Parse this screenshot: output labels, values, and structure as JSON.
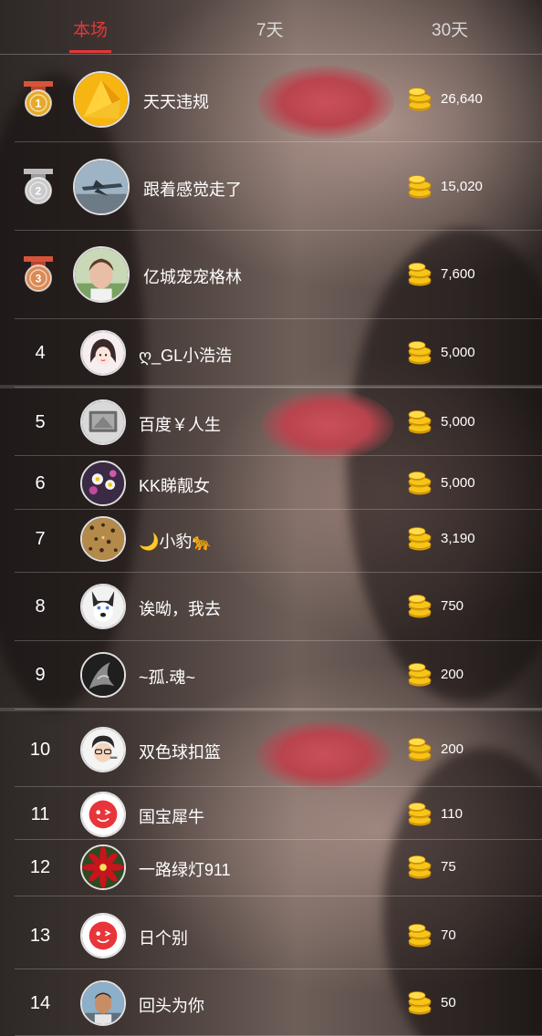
{
  "tabs": [
    {
      "label": "本场",
      "active": true
    },
    {
      "label": "7天",
      "active": false
    },
    {
      "label": "30天",
      "active": false
    }
  ],
  "colors": {
    "accent": "#e8353a",
    "coin": "#f5c518",
    "gold_medal": "#e7a92a",
    "silver_medal": "#c9c9c9",
    "bronze_medal": "#d98a55"
  },
  "ranking": [
    {
      "rank": "1",
      "medal": "gold",
      "name": "天天违规",
      "amount": "26,640",
      "avatar": "yellow-geometric-avatar"
    },
    {
      "rank": "2",
      "medal": "silver",
      "name": "跟着感觉走了",
      "amount": "15,020",
      "avatar": "airplane-avatar"
    },
    {
      "rank": "3",
      "medal": "bronze",
      "name": "亿城宠宠格林",
      "amount": "7,600",
      "avatar": "selfie-avatar"
    },
    {
      "rank": "4",
      "medal": "",
      "name": "ღ_GL小浩浩",
      "amount": "5,000",
      "avatar": "cartoon-girl-avatar"
    },
    {
      "rank": "5",
      "medal": "",
      "name": "百度￥人生",
      "amount": "5,000",
      "avatar": "screen-avatar"
    },
    {
      "rank": "6",
      "medal": "",
      "name": "KK睇靓女",
      "amount": "5,000",
      "avatar": "flowers-avatar"
    },
    {
      "rank": "7",
      "medal": "",
      "name": "🌙小豹🐆",
      "amount": "3,190",
      "avatar": "leopard-avatar"
    },
    {
      "rank": "8",
      "medal": "",
      "name": "诶呦，我去",
      "amount": "750",
      "avatar": "husky-avatar"
    },
    {
      "rank": "9",
      "medal": "",
      "name": "~孤.魂~",
      "amount": "200",
      "avatar": "dark-art-avatar"
    },
    {
      "rank": "10",
      "medal": "",
      "name": "双色球扣篮",
      "amount": "200",
      "avatar": "cartoon-boy-avatar"
    },
    {
      "rank": "11",
      "medal": "",
      "name": "国宝犀牛",
      "amount": "110",
      "avatar": "default-red-avatar"
    },
    {
      "rank": "12",
      "medal": "",
      "name": "一路绿灯911",
      "amount": "75",
      "avatar": "red-flower-avatar"
    },
    {
      "rank": "13",
      "medal": "",
      "name": "日个别",
      "amount": "70",
      "avatar": "default-red-avatar"
    },
    {
      "rank": "14",
      "medal": "",
      "name": "回头为你",
      "amount": "50",
      "avatar": "man-photo-avatar"
    }
  ]
}
